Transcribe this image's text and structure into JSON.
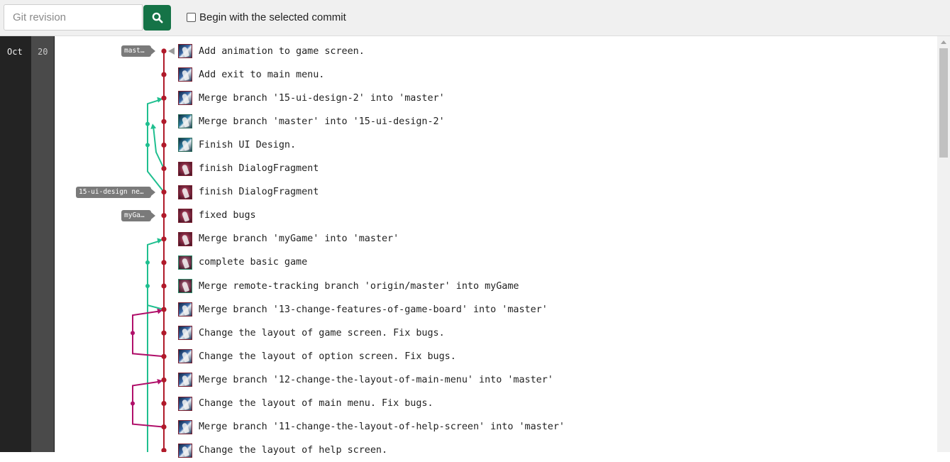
{
  "toolbar": {
    "revision_placeholder": "Git revision",
    "search_icon": "search-icon",
    "begin_checkbox_label": "Begin with the selected commit",
    "begin_checkbox_checked": false
  },
  "dates": {
    "month": "Oct",
    "day": "20"
  },
  "refs": [
    {
      "label": "master",
      "row": 0
    },
    {
      "label": "15-ui-design ne…",
      "row": 6
    },
    {
      "label": "myGame",
      "row": 7
    }
  ],
  "commits": [
    {
      "message": "Add animation to game screen.",
      "avatar": "a1"
    },
    {
      "message": "Add exit to main menu.",
      "avatar": "a1"
    },
    {
      "message": "Merge branch '15-ui-design-2' into 'master'",
      "avatar": "a1"
    },
    {
      "message": "Merge branch 'master' into '15-ui-design-2'",
      "avatar": "a3"
    },
    {
      "message": "Finish UI Design.",
      "avatar": "a3"
    },
    {
      "message": "finish DialogFragment",
      "avatar": "a2"
    },
    {
      "message": "finish DialogFragment",
      "avatar": "a2"
    },
    {
      "message": "fixed bugs",
      "avatar": "a2"
    },
    {
      "message": "Merge branch 'myGame' into 'master'",
      "avatar": "a2"
    },
    {
      "message": "complete basic game",
      "avatar": "a4"
    },
    {
      "message": "Merge remote-tracking branch 'origin/master' into myGame",
      "avatar": "a4"
    },
    {
      "message": "Merge branch '13-change-features-of-game-board' into 'master'",
      "avatar": "a1"
    },
    {
      "message": "Change the layout of game screen. Fix bugs.",
      "avatar": "a1"
    },
    {
      "message": "Change the layout of option screen. Fix bugs.",
      "avatar": "a1"
    },
    {
      "message": "Merge branch '12-change-the-layout-of-main-menu' into 'master'",
      "avatar": "a1"
    },
    {
      "message": "Change the layout of main menu. Fix bugs.",
      "avatar": "a1"
    },
    {
      "message": "Merge branch '11-change-the-layout-of-help-screen' into 'master'",
      "avatar": "a1"
    },
    {
      "message": "Change the layout of help screen.",
      "avatar": "a1"
    }
  ],
  "graph_colors": {
    "master": "#b01a2a",
    "feature": "#1fbf8f",
    "side": "#b0106a"
  }
}
